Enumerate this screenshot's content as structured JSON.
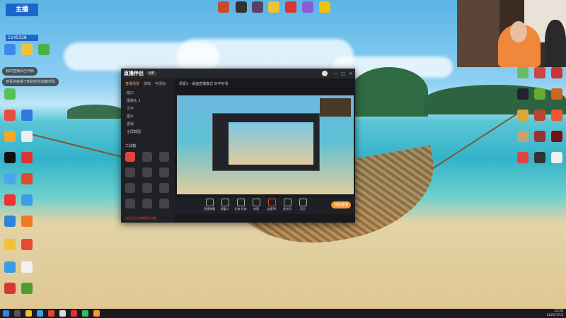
{
  "desktop": {
    "badge": {
      "text_top": "主播",
      "text_num": "1145328"
    },
    "notifications": [
      "我的直播间已开启",
      "恭喜你获得了新的粉丝勋章奖励"
    ]
  },
  "app": {
    "title": "直播伴侣",
    "title_tag": "VIP",
    "tabs": [
      "直播场景",
      "游戏",
      "可添加"
    ],
    "scene_title": "场景1 - 桌面直播模式  好不好看",
    "sources": [
      "窗口",
      "摄像头 1",
      "文字",
      "图片",
      "游戏",
      "全屏截图"
    ],
    "tools_label": "工具箱",
    "start_label": "开始直播",
    "footer_note": "点击开启工具箱更多功能",
    "controls": [
      "直播弹幕",
      "观看人",
      "礼物 礼物",
      "房管",
      "连麦PK",
      "麦克风",
      "音乐"
    ]
  },
  "taskbar": {
    "time": "12:28",
    "date": "2021/7/15"
  },
  "colors": {
    "accent": "#f49a34",
    "app_bg": "#1e1f24",
    "tab_active": "#f7a35c"
  }
}
